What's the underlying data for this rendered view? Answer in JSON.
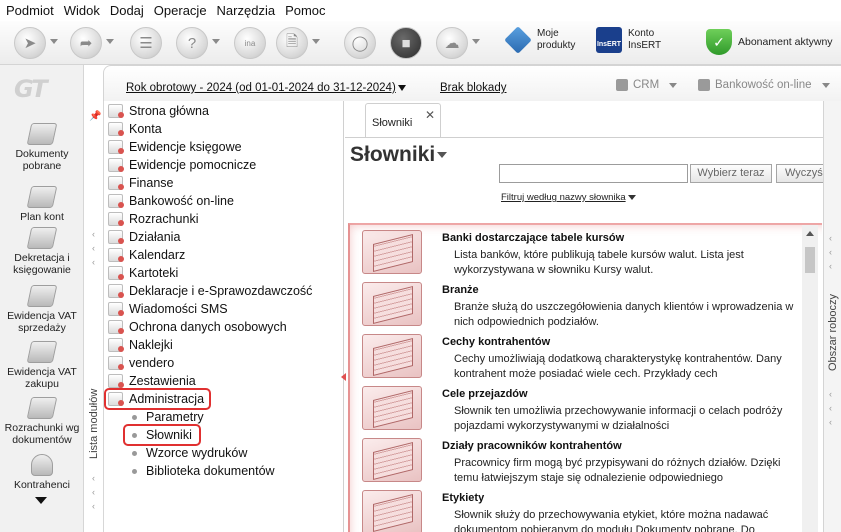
{
  "menu": [
    "Podmiot",
    "Widok",
    "Dodaj",
    "Operacje",
    "Narzędzia",
    "Pomoc"
  ],
  "toolbar": {
    "moje_produkty": "Moje\nprodukty",
    "konto_insert": "Konto\nInsERT",
    "insert_logo": "InsERT",
    "abonament": "Abonament aktywny"
  },
  "left_strip": {
    "logo": "GT",
    "items": [
      "Dokumenty pobrane",
      "Plan kont",
      "Dekretacja i księgowanie",
      "Ewidencja VAT sprzedaży",
      "Ewidencja VAT zakupu",
      "Rozrachunki wg dokumentów",
      "Kontrahenci"
    ]
  },
  "header": {
    "year": "Rok obrotowy - 2024  (od 01-01-2024 do 31-12-2024)",
    "lock": "Brak blokady",
    "crm": "CRM",
    "bank": "Bankowość on-line"
  },
  "modules": {
    "caption": "Lista modułów",
    "items": [
      "Strona główna",
      "Konta",
      "Ewidencje księgowe",
      "Ewidencje pomocnicze",
      "Finanse",
      "Bankowość on-line",
      "Rozrachunki",
      "Działania",
      "Kalendarz",
      "Kartoteki",
      "Deklaracje i e-Sprawozdawczość",
      "Wiadomości SMS",
      "Ochrona danych osobowych",
      "Naklejki",
      "vendero",
      "Zestawienia",
      "Administracja"
    ],
    "subitems": [
      "Parametry",
      "Słowniki",
      "Wzorce wydruków",
      "Biblioteka dokumentów"
    ]
  },
  "main": {
    "tab": "Słowniki",
    "title": "Słowniki",
    "choose_button": "Wybierz teraz",
    "clear_button": "Wyczyść",
    "filter": "Filtruj według nazwy słownika",
    "dictionaries": [
      {
        "title": "Banki dostarczające tabele kursów",
        "desc": "Lista banków, które publikują tabele kursów walut. Lista jest wykorzystywana w słowniku Kursy walut."
      },
      {
        "title": "Branże",
        "desc": "Branże służą do uszczegółowienia danych klientów i wprowadzenia w nich odpowiednich podziałów."
      },
      {
        "title": "Cechy kontrahentów",
        "desc": "Cechy umożliwiają dodatkową charakterystykę kontrahentów. Dany kontrahent może posiadać wiele cech. Przykłady cech"
      },
      {
        "title": "Cele przejazdów",
        "desc": "Słownik ten umożliwia przechowywanie informacji o celach podróży pojazdami wykorzystywanymi w działalności"
      },
      {
        "title": "Działy pracowników kontrahentów",
        "desc": "Pracownicy firm mogą być przypisywani do różnych działów. Dzięki temu łatwiejszym staje się odnalezienie odpowiedniego"
      },
      {
        "title": "Etykiety",
        "desc": "Słownik służy do przechowywania etykiet, które można nadawać dokumentom pobieranym do modułu Dokumenty pobrane. Do"
      }
    ]
  },
  "right_strip": {
    "caption": "Obszar roboczy"
  },
  "colors": {
    "highlight": "#e03030",
    "list_border": "#e8a0a0"
  }
}
